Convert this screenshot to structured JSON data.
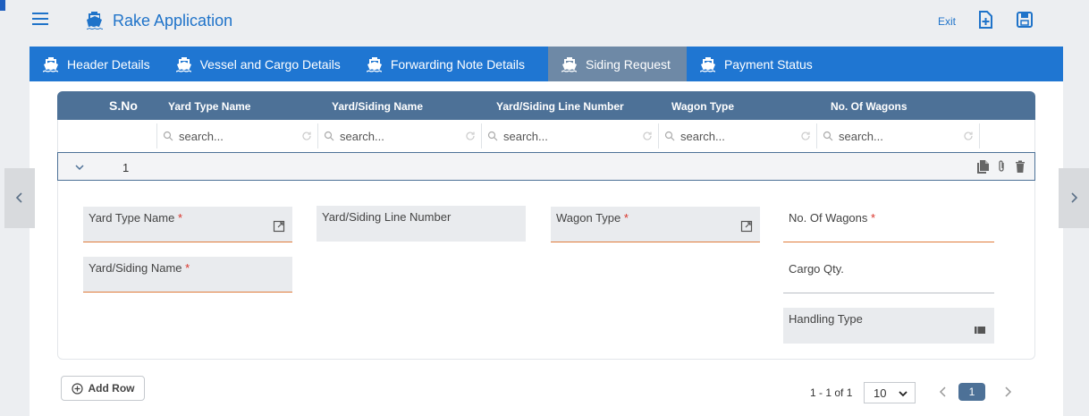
{
  "app": {
    "title": "Rake Application",
    "exit_label": "Exit"
  },
  "tabs": [
    {
      "label": "Header Details",
      "active": false
    },
    {
      "label": "Vessel and Cargo Details",
      "active": false
    },
    {
      "label": "Forwarding Note Details",
      "active": false
    },
    {
      "label": "Siding Request",
      "active": true
    },
    {
      "label": "Payment Status",
      "active": false
    }
  ],
  "grid": {
    "columns": [
      "S.No",
      "Yard Type Name",
      "Yard/Siding Name",
      "Yard/Siding Line Number",
      "Wagon Type",
      "No. Of Wagons"
    ],
    "search_placeholder": "search...",
    "rows": [
      {
        "sno": "1"
      }
    ]
  },
  "detail": {
    "yard_type_name": "Yard Type Name",
    "yard_siding_line_number": "Yard/Siding Line Number",
    "wagon_type": "Wagon Type",
    "no_of_wagons": "No. Of Wagons",
    "yard_siding_name": "Yard/Siding Name",
    "cargo_qty": "Cargo Qty.",
    "handling_type": "Handling Type",
    "required_mark": "*"
  },
  "footer": {
    "add_row_label": "Add Row",
    "range_text": "1 - 1 of 1",
    "page_size": "10",
    "current_page": "1"
  },
  "colors": {
    "accent": "#1f76d2",
    "grid_header": "#4d7197",
    "active_tab": "#6e89a6",
    "required": "#d9342b"
  }
}
